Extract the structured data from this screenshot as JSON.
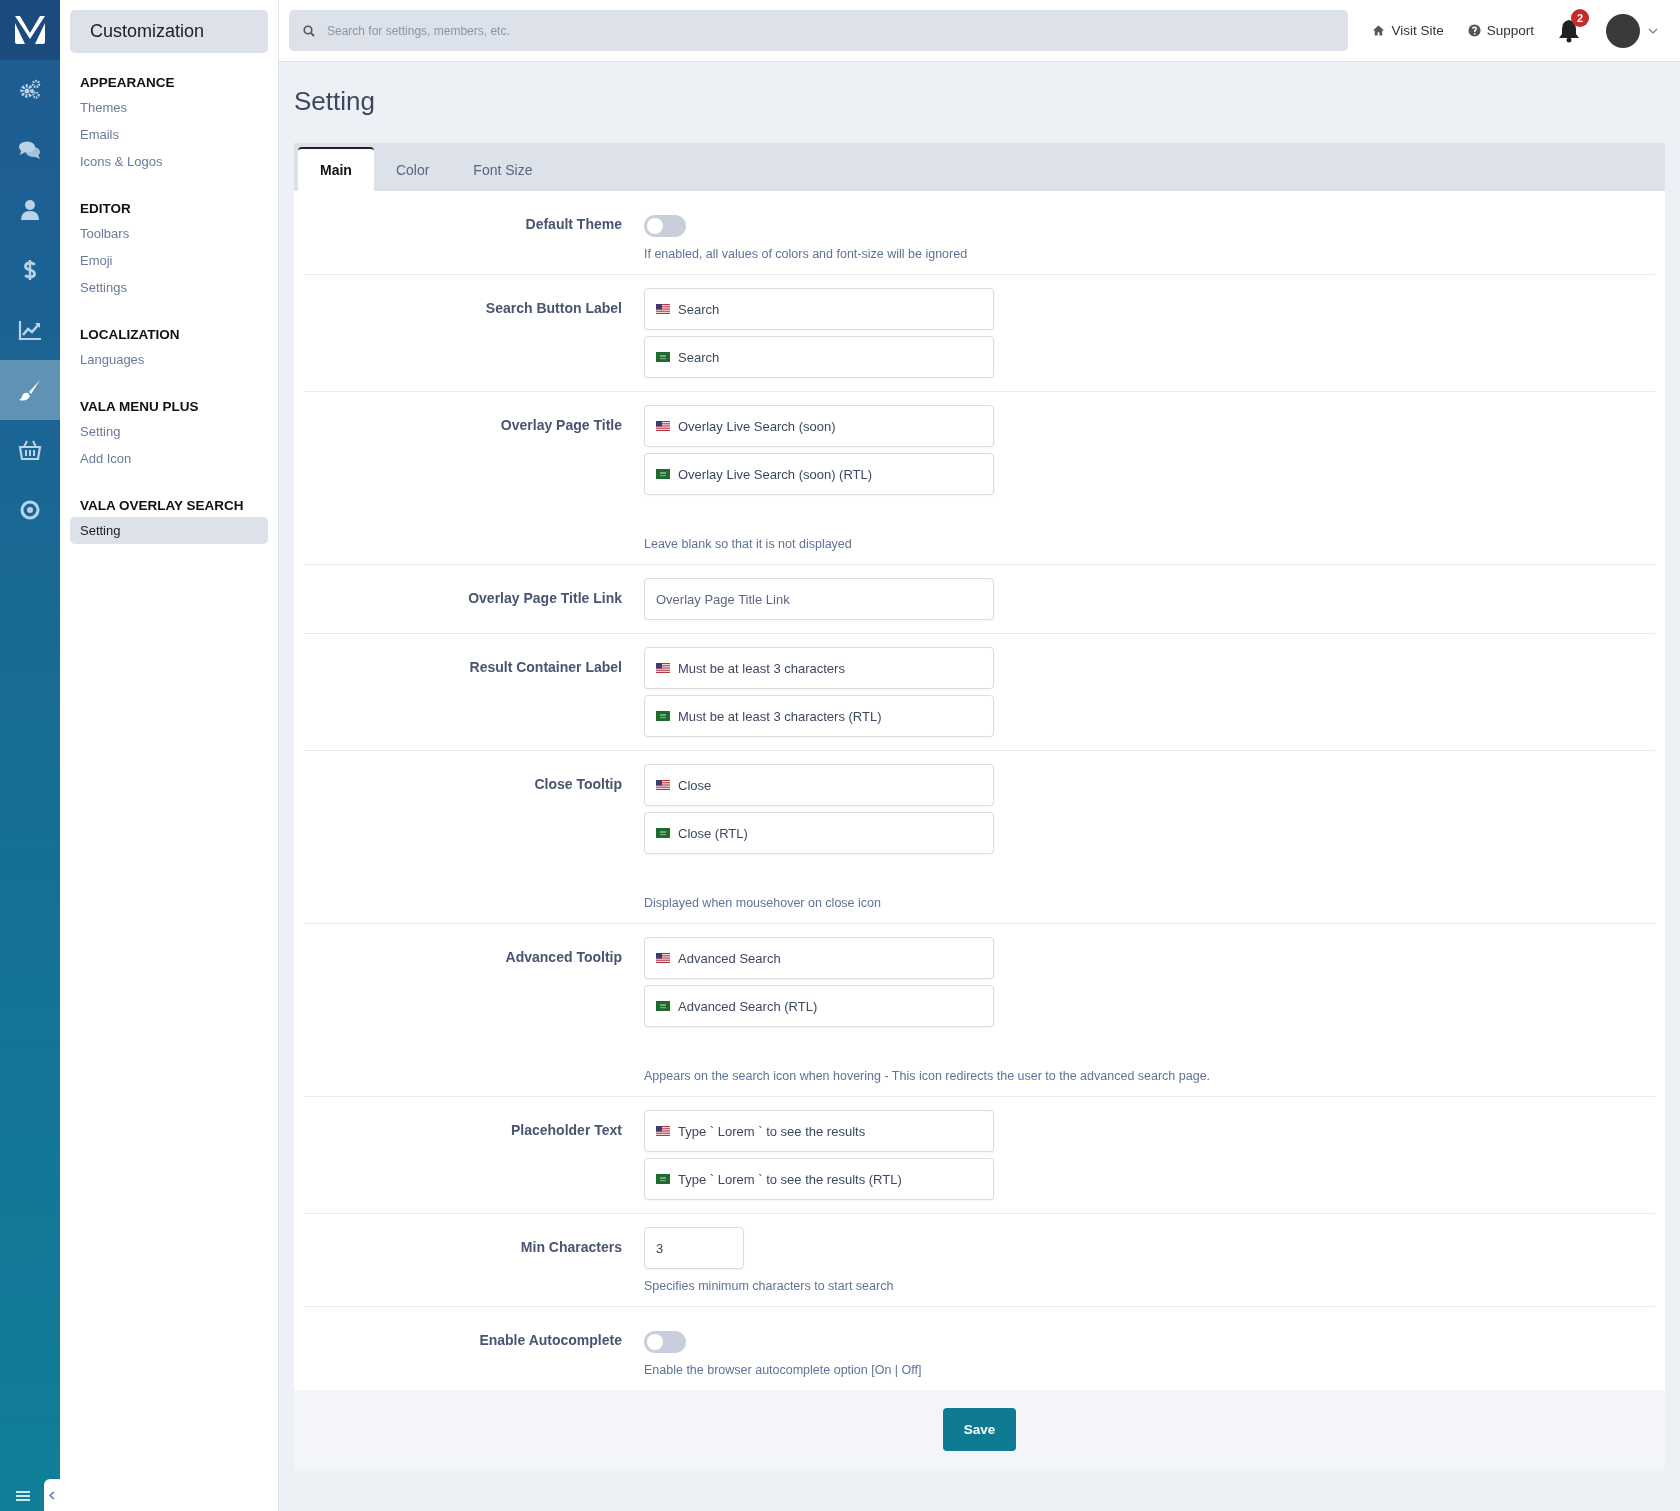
{
  "rail": [
    {
      "kind": "gears",
      "selected": false
    },
    {
      "kind": "chat",
      "selected": false
    },
    {
      "kind": "user",
      "selected": false
    },
    {
      "kind": "dollar",
      "selected": false
    },
    {
      "kind": "chart",
      "selected": false
    },
    {
      "kind": "brush",
      "selected": true
    },
    {
      "kind": "basket",
      "selected": false
    },
    {
      "kind": "target",
      "selected": false
    }
  ],
  "sidebar": {
    "title": "Customization",
    "sections": [
      {
        "heading": "APPEARANCE",
        "items": [
          {
            "label": "Themes",
            "selected": false
          },
          {
            "label": "Emails",
            "selected": false
          },
          {
            "label": "Icons & Logos",
            "selected": false
          }
        ]
      },
      {
        "heading": "EDITOR",
        "items": [
          {
            "label": "Toolbars",
            "selected": false
          },
          {
            "label": "Emoji",
            "selected": false
          },
          {
            "label": "Settings",
            "selected": false
          }
        ]
      },
      {
        "heading": "LOCALIZATION",
        "items": [
          {
            "label": "Languages",
            "selected": false
          }
        ]
      },
      {
        "heading": "VALA MENU PLUS",
        "items": [
          {
            "label": "Setting",
            "selected": false
          },
          {
            "label": "Add Icon",
            "selected": false
          }
        ]
      },
      {
        "heading": "VALA OVERLAY SEARCH",
        "items": [
          {
            "label": "Setting",
            "selected": true
          }
        ]
      }
    ]
  },
  "topbar": {
    "search": {
      "placeholder": "Search for settings, members, etc."
    },
    "links": [
      {
        "kind": "home",
        "label": "Visit Site"
      },
      {
        "kind": "help",
        "label": "Support"
      }
    ],
    "notifications": "2"
  },
  "page_title": "Setting",
  "tabs": [
    {
      "label": "Main",
      "selected": true
    },
    {
      "label": "Color",
      "selected": false
    },
    {
      "label": "Font Size",
      "selected": false
    }
  ],
  "rows": [
    {
      "label": "Default Theme",
      "kind": "toggle",
      "on": false,
      "hint": "If enabled, all values of colors and font-size will be ignored"
    },
    {
      "label": "Search Button Label",
      "kind": "multilang",
      "fields": [
        {
          "kind": "us",
          "value": "Search"
        },
        {
          "kind": "sa",
          "value": "Search"
        }
      ]
    },
    {
      "label": "Overlay Page Title",
      "kind": "multilang",
      "fields": [
        {
          "kind": "us",
          "value": "Overlay Live Search (soon)"
        },
        {
          "kind": "sa",
          "value": "Overlay Live Search (soon) (RTL)"
        }
      ],
      "hint": "Leave blank so that it is not displayed"
    },
    {
      "label": "Overlay Page Title Link",
      "kind": "text",
      "placeholder": "Overlay Page Title Link"
    },
    {
      "label": "Result Container Label",
      "kind": "multilang",
      "fields": [
        {
          "kind": "us",
          "value": "Must be at least 3 characters"
        },
        {
          "kind": "sa",
          "value": "Must be at least 3 characters (RTL)"
        }
      ]
    },
    {
      "label": "Close Tooltip",
      "kind": "multilang",
      "fields": [
        {
          "kind": "us",
          "value": "Close"
        },
        {
          "kind": "sa",
          "value": "Close (RTL)"
        }
      ],
      "hint": "Displayed when mousehover on close icon"
    },
    {
      "label": "Advanced Tooltip",
      "kind": "multilang",
      "fields": [
        {
          "kind": "us",
          "value": "Advanced Search"
        },
        {
          "kind": "sa",
          "value": "Advanced Search (RTL)"
        }
      ],
      "hint": "Appears on the search icon when hovering - This icon redirects the user to the advanced search page."
    },
    {
      "label": "Placeholder Text",
      "kind": "multilang",
      "fields": [
        {
          "kind": "us",
          "value": "Type ` Lorem ` to see the results"
        },
        {
          "kind": "sa",
          "value": "Type ` Lorem ` to see the results (RTL)"
        }
      ]
    },
    {
      "label": "Min Characters",
      "kind": "number",
      "value": "3",
      "hint": "Specifies minimum characters to start search"
    },
    {
      "label": "Enable Autocomplete",
      "kind": "toggle",
      "on": false,
      "hint": "Enable the browser autocomplete option [On | Off]"
    }
  ],
  "save_button": "Save"
}
